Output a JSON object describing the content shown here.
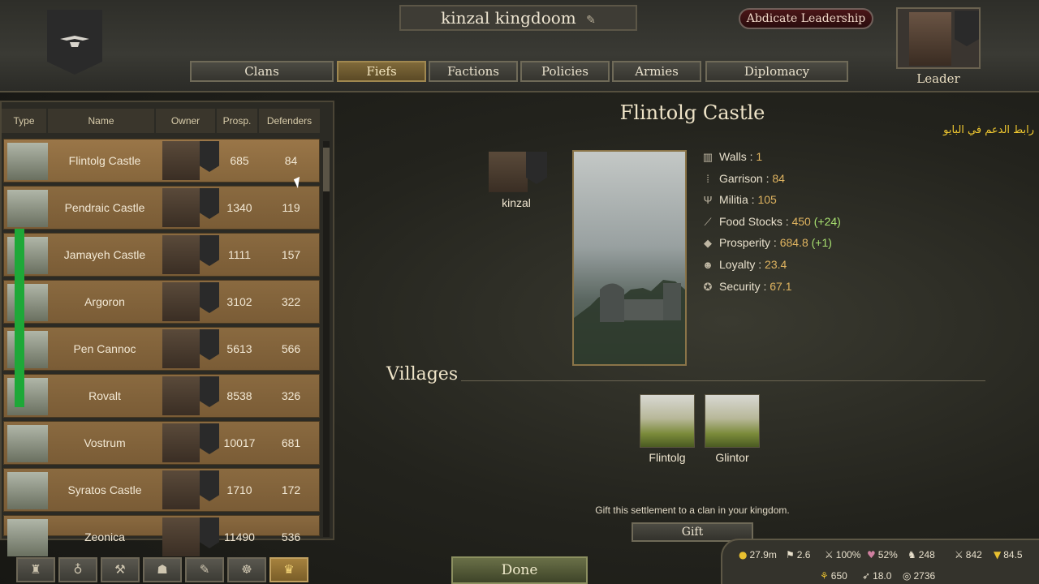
{
  "header": {
    "kingdom_name": "kinzal kingdoom",
    "abdicate_label": "Abdicate Leadership",
    "leader_label": "Leader"
  },
  "tabs": [
    {
      "label": "Clans",
      "active": false
    },
    {
      "label": "Fiefs",
      "active": true
    },
    {
      "label": "Factions",
      "active": false
    },
    {
      "label": "Policies",
      "active": false
    },
    {
      "label": "Armies",
      "active": false
    },
    {
      "label": "Diplomacy",
      "active": false
    }
  ],
  "fief_list": {
    "columns": [
      "Type",
      "Name",
      "Owner",
      "Prosp.",
      "Defenders"
    ],
    "rows": [
      {
        "name": "Flintolg Castle",
        "prosperity": "685",
        "defenders": "84"
      },
      {
        "name": "Pendraic Castle",
        "prosperity": "1340",
        "defenders": "119"
      },
      {
        "name": "Jamayeh Castle",
        "prosperity": "1111",
        "defenders": "157"
      },
      {
        "name": "Argoron",
        "prosperity": "3102",
        "defenders": "322"
      },
      {
        "name": "Pen Cannoc",
        "prosperity": "5613",
        "defenders": "566"
      },
      {
        "name": "Rovalt",
        "prosperity": "8538",
        "defenders": "326"
      },
      {
        "name": "Vostrum",
        "prosperity": "10017",
        "defenders": "681"
      },
      {
        "name": "Syratos Castle",
        "prosperity": "1710",
        "defenders": "172"
      },
      {
        "name": "Zeonica",
        "prosperity": "11490",
        "defenders": "536"
      }
    ]
  },
  "detail": {
    "title": "Flintolg Castle",
    "arabic_note": "رابط الدعم في البايو",
    "owner_name": "kinzal",
    "stats": [
      {
        "icon": "walls-icon",
        "glyph": "▥",
        "label": "Walls :",
        "value": "1",
        "change": ""
      },
      {
        "icon": "garrison-icon",
        "glyph": "⁞",
        "label": "Garrison :",
        "value": "84",
        "change": ""
      },
      {
        "icon": "militia-icon",
        "glyph": "Ψ",
        "label": "Militia :",
        "value": "105",
        "change": ""
      },
      {
        "icon": "food-icon",
        "glyph": "⟋",
        "label": "Food Stocks :",
        "value": "450",
        "change": "(+24)"
      },
      {
        "icon": "prosperity-icon",
        "glyph": "◆",
        "label": "Prosperity :",
        "value": "684.8",
        "change": "(+1)"
      },
      {
        "icon": "loyalty-icon",
        "glyph": "☻",
        "label": "Loyalty :",
        "value": "23.4",
        "change": ""
      },
      {
        "icon": "security-icon",
        "glyph": "✪",
        "label": "Security :",
        "value": "67.1",
        "change": ""
      }
    ],
    "villages_title": "Villages",
    "villages": [
      "Flintolg",
      "Glintor"
    ],
    "gift_text": "Gift this settlement to a clan in your kingdom.",
    "gift_label": "Gift"
  },
  "footer": {
    "done_label": "Done",
    "nav_icons": [
      {
        "name": "helmet-icon",
        "glyph": "♜",
        "active": false
      },
      {
        "name": "bag-icon",
        "glyph": "♁",
        "active": false
      },
      {
        "name": "anvil-icon",
        "glyph": "⚒",
        "active": false
      },
      {
        "name": "party-icon",
        "glyph": "☗",
        "active": false
      },
      {
        "name": "quest-icon",
        "glyph": "✎",
        "active": false
      },
      {
        "name": "clan-icon",
        "glyph": "☸",
        "active": false
      },
      {
        "name": "kingdom-icon",
        "glyph": "♛",
        "active": true
      }
    ]
  },
  "resources": {
    "gold": "27.9m",
    "influence": "2.6",
    "morale": "100%",
    "health": "52%",
    "troops": "248",
    "army": "842",
    "kingdom_power": "84.5",
    "food": "650",
    "speed": "18.0",
    "view": "2736"
  },
  "sidebar_overlay": {
    "bar_fill": 1.0
  }
}
